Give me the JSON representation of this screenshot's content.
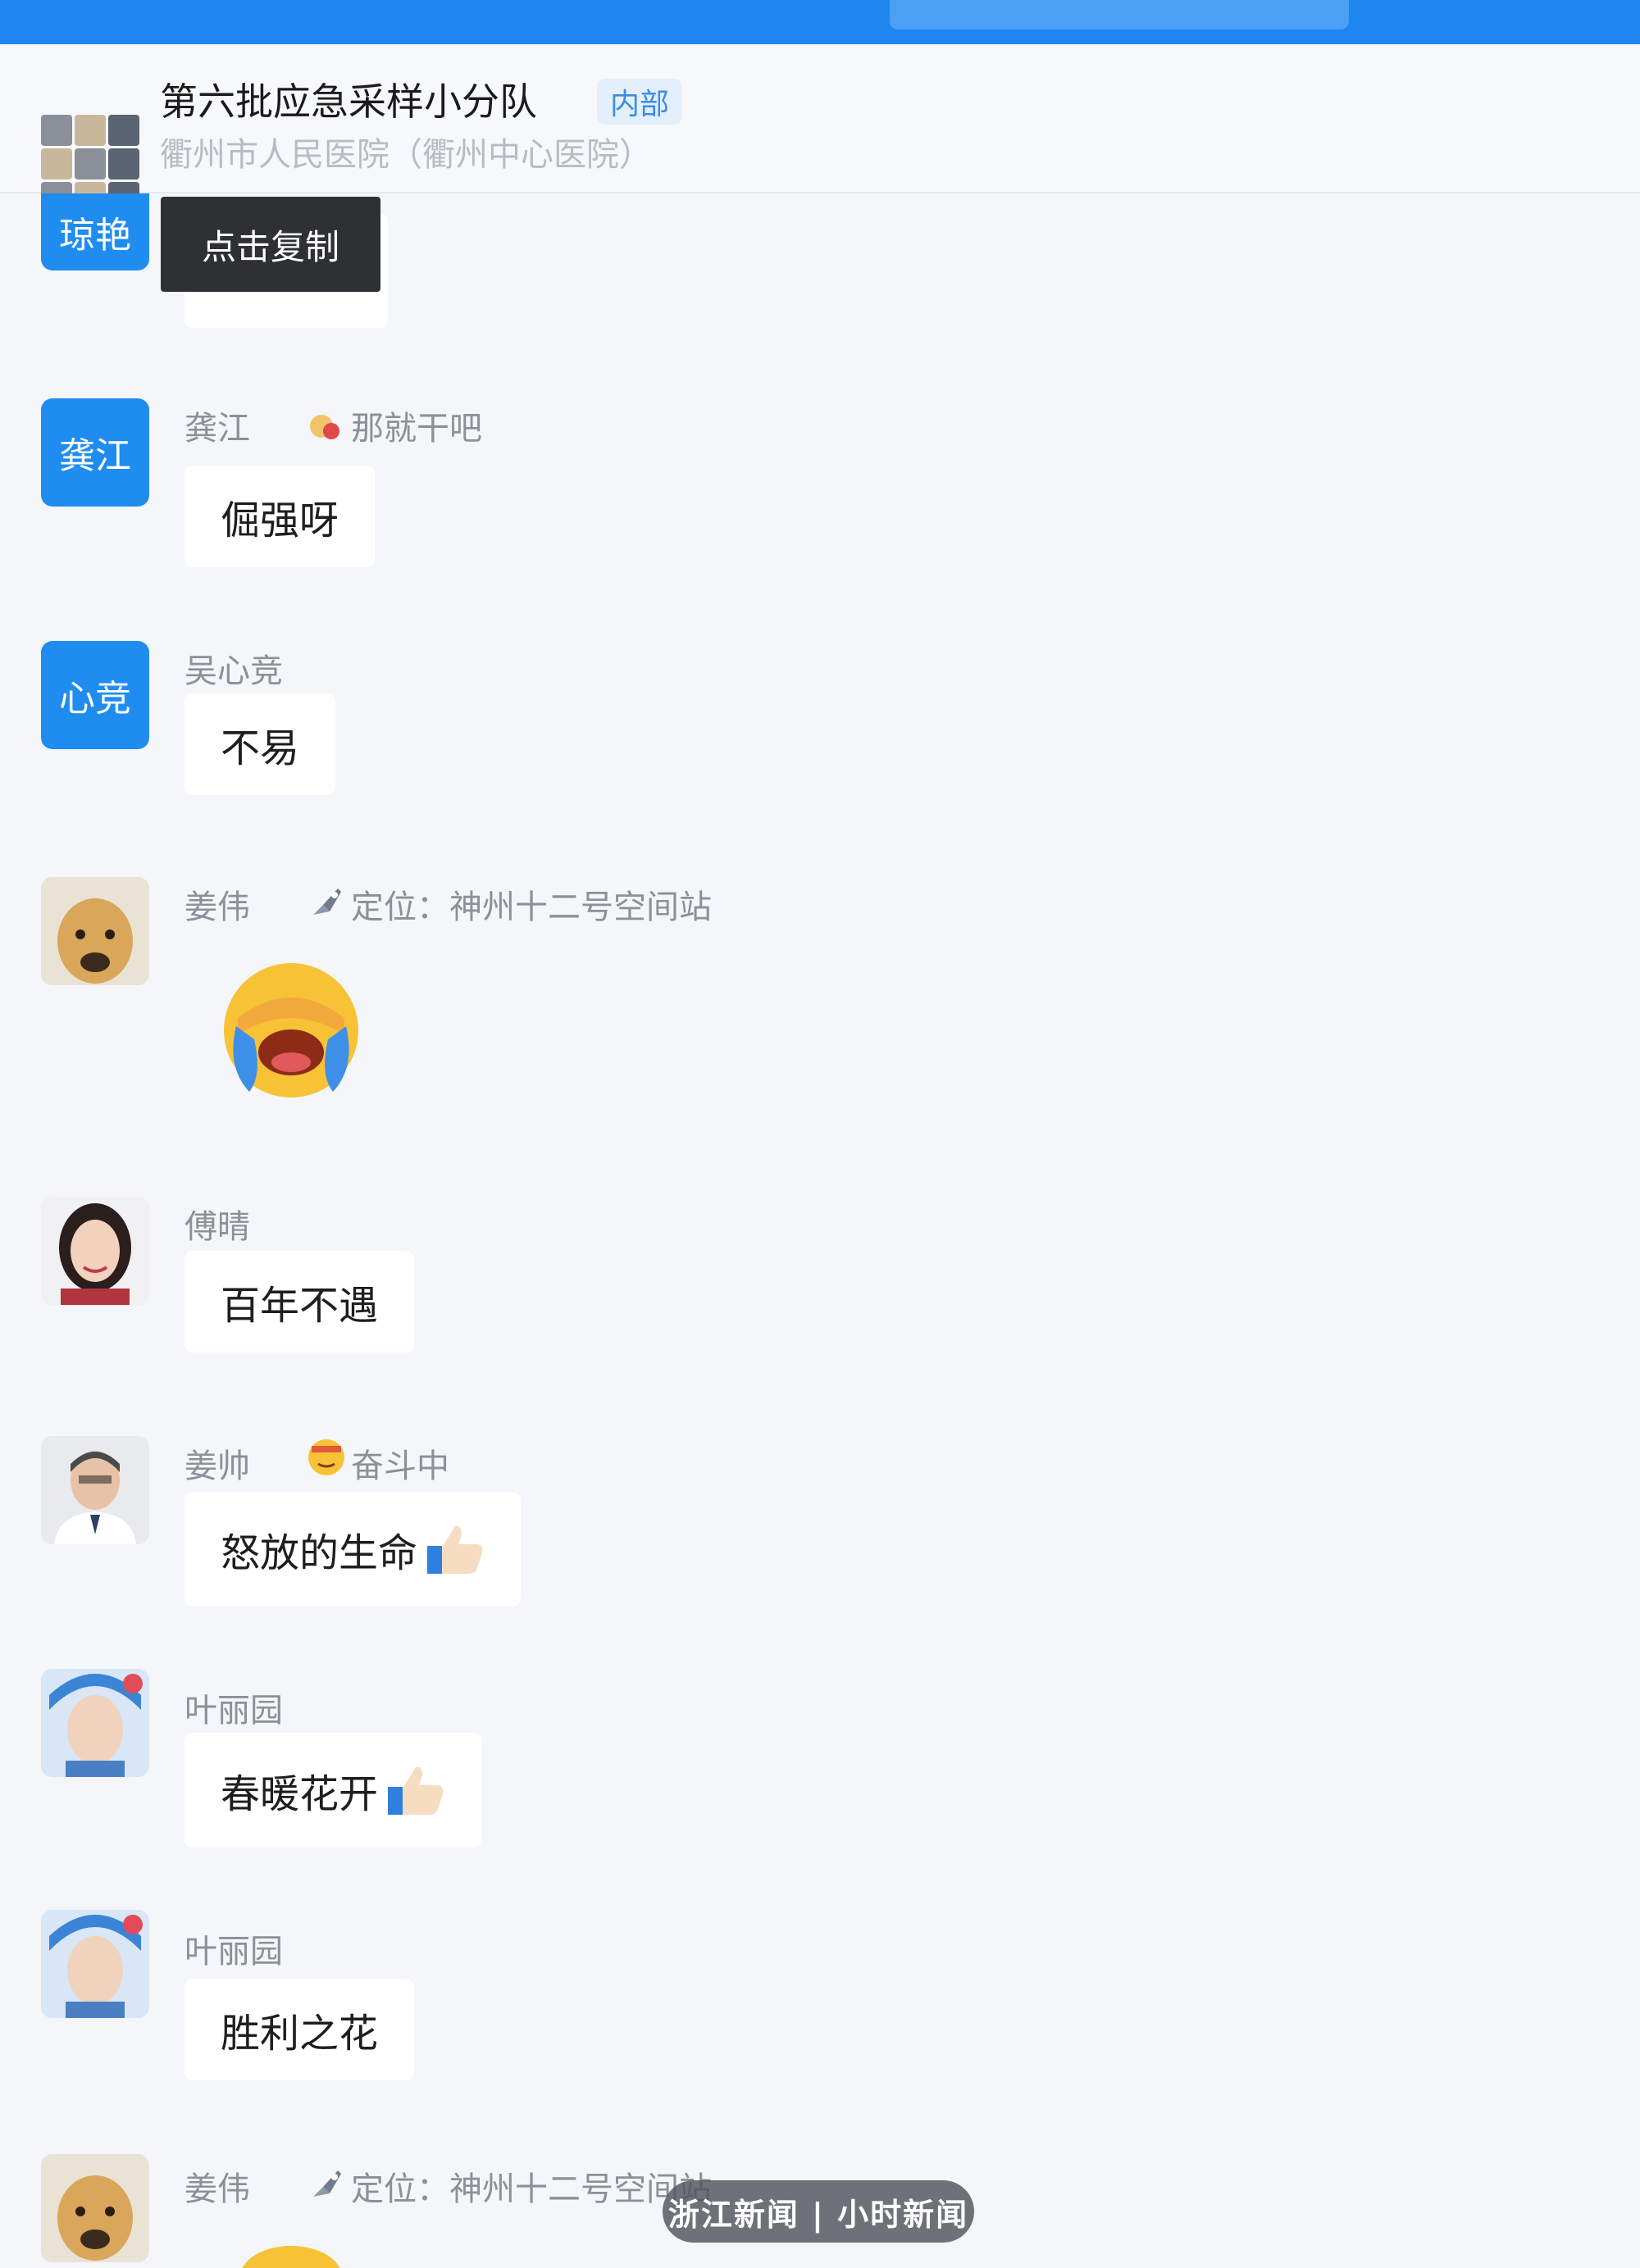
{
  "header": {
    "group_name": "第六批应急采样小分队",
    "group_tag": "内部",
    "organization": "衢州市人民医院（衢州中心医院）"
  },
  "tooltip": {
    "label": "点击复制"
  },
  "messages": [
    {
      "avatar_text": "琼艳",
      "sender": "",
      "status": "",
      "text": ""
    },
    {
      "avatar_text": "龚江",
      "sender": "龚江",
      "status": "那就干吧",
      "text": "倔强呀"
    },
    {
      "avatar_text": "心竞",
      "sender": "吴心竞",
      "status": "",
      "text": "不易"
    },
    {
      "avatar_text": "",
      "sender": "姜伟",
      "status": "定位：神州十二号空间站",
      "text": "",
      "sticker": "face-with-tears-emoji"
    },
    {
      "avatar_text": "",
      "sender": "傅晴",
      "status": "",
      "text": "百年不遇"
    },
    {
      "avatar_text": "",
      "sender": "姜帅",
      "status": "奋斗中",
      "text": "怒放的生命",
      "emoji": "thumbs-up-icon"
    },
    {
      "avatar_text": "",
      "sender": "叶丽园",
      "status": "",
      "text": "春暖花开",
      "emoji": "thumbs-up-icon"
    },
    {
      "avatar_text": "",
      "sender": "叶丽园",
      "status": "",
      "text": "胜利之花"
    },
    {
      "avatar_text": "",
      "sender": "姜伟",
      "status": "定位：神州十二号空间站",
      "text": ""
    }
  ],
  "watermark": {
    "text": "浙江新闻 | 小时新闻"
  },
  "colors": {
    "brand_blue": "#1f86f0",
    "background": "#f4f6f9",
    "bubble": "#ffffff",
    "tooltip_bg": "#2e3033",
    "meta_text": "#8b9099"
  }
}
